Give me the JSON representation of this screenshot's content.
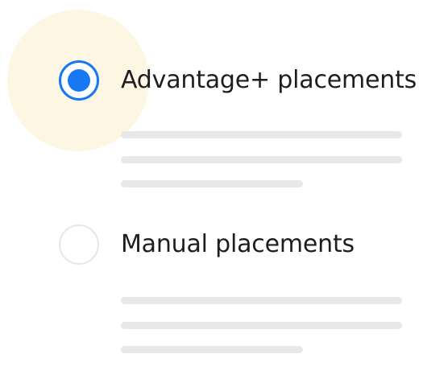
{
  "colors": {
    "accent": "#1877f2",
    "highlight": "#fdf6e3",
    "placeholder_line": "#e8e8e8",
    "radio_border_unselected": "#e6e6e6"
  },
  "options": [
    {
      "label": "Advantage+ placements",
      "selected": true
    },
    {
      "label": "Manual placements",
      "selected": false
    }
  ]
}
